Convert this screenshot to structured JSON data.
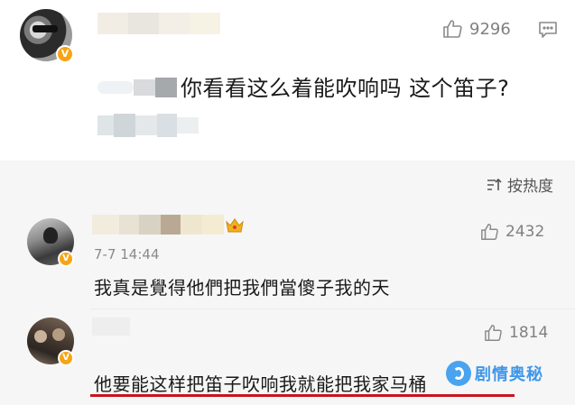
{
  "post": {
    "likes": "9296",
    "text": "你看看这么着能吹响吗 这个笛子?"
  },
  "sort": {
    "label": "按热度"
  },
  "comments": [
    {
      "time": "7-7 14:44",
      "likes": "2432",
      "text": "我真是覺得他們把我們當傻子我的天"
    },
    {
      "likes": "1814",
      "text": "他要能这样把笛子吹响我就能把我家马桶"
    }
  ],
  "watermark": {
    "text": "剧情奥秘"
  },
  "colors": {
    "verified_badge": "#f7a414",
    "underline": "#c8141e",
    "watermark": "#3f97ea",
    "gray_bg": "#f6f6f6"
  }
}
